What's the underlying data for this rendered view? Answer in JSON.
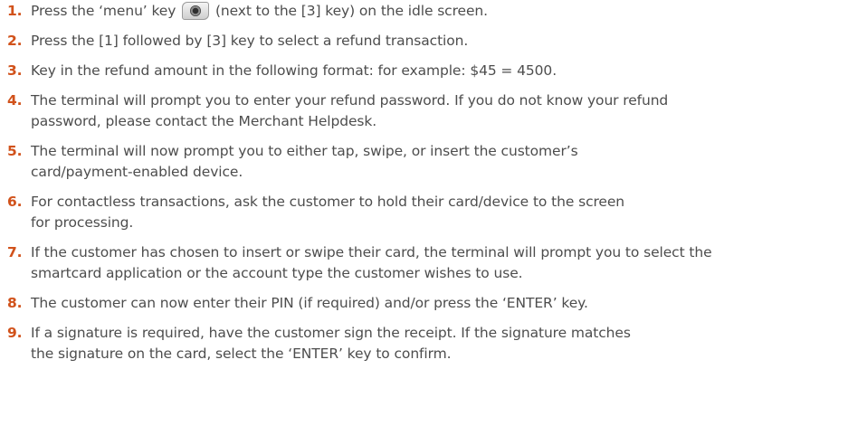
{
  "steps": [
    {
      "number": "1.",
      "text_before": "Press the ‘menu’ key",
      "icon": "menu-key-icon",
      "text_after": "(next to the [3] key) on the idle screen."
    },
    {
      "number": "2.",
      "text": "Press the [1] followed by [3] key to select a refund transaction."
    },
    {
      "number": "3.",
      "text": "Key in the refund amount in the following format: for example: $45 = 4500."
    },
    {
      "number": "4.",
      "text": "The terminal will prompt you to enter your refund password. If you do not know your refund\npassword, please contact the Merchant Helpdesk."
    },
    {
      "number": "5.",
      "text": "The terminal will now prompt you to either tap, swipe, or insert the customer’s\ncard/payment-enabled device."
    },
    {
      "number": "6.",
      "text": "For contactless transactions, ask the customer to hold their card/device to the screen\nfor processing."
    },
    {
      "number": "7.",
      "text": "If the customer has chosen to insert or swipe their card, the terminal will prompt you to select the\nsmartcard application or the account type the customer wishes to use."
    },
    {
      "number": "8.",
      "text": "The customer can now enter their PIN (if required) and/or press the ‘ENTER’ key."
    },
    {
      "number": "9.",
      "text": "If a signature is required, have the customer sign the receipt. If the signature matches\nthe signature on the card, select the ‘ENTER’ key to confirm."
    }
  ],
  "colors": {
    "step_number": "#d1521b",
    "body_text": "#4d4d4d"
  }
}
